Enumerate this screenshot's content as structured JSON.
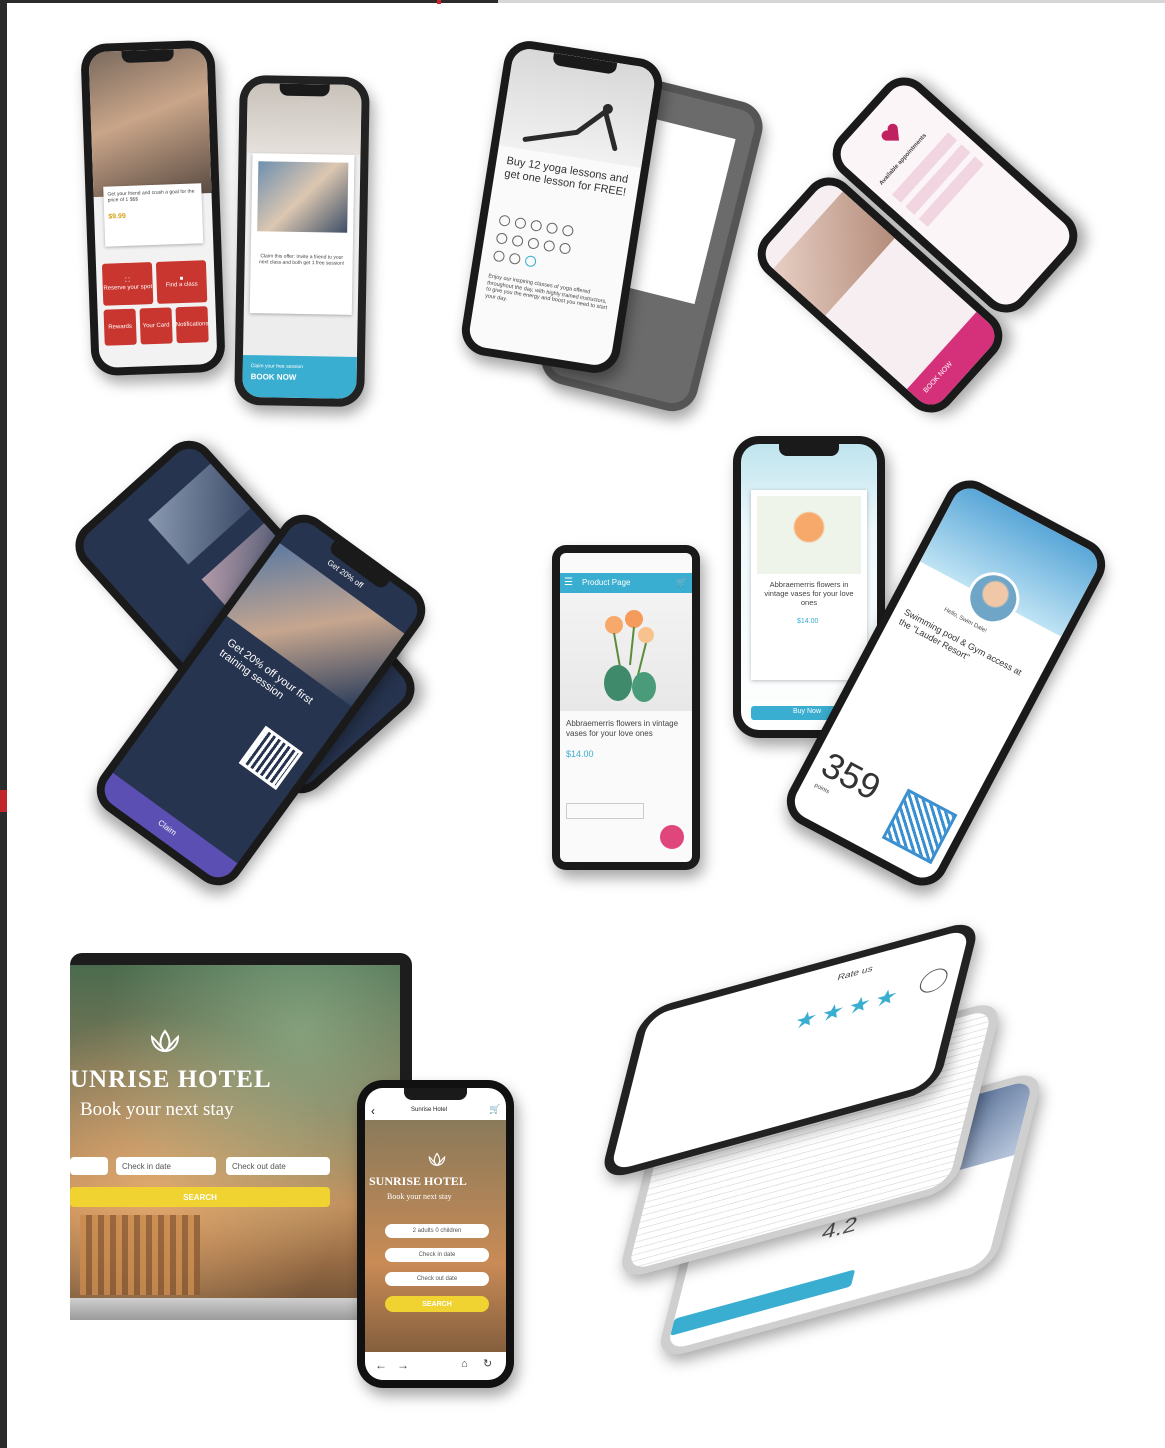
{
  "gym": {
    "promo_text": "Get your friend and crush a goal for the price of 1 $$$",
    "price": "$9.99",
    "tiles": [
      "Reserve your spot",
      "Find a class",
      "Rewards",
      "Your Card",
      "Notifications"
    ],
    "book_label": "BOOK NOW",
    "book_caption": "Claim your free session",
    "offer_text": "Claim this offer: Invite a friend to your next class and both get 1 free session!"
  },
  "yoga": {
    "headline": "Buy 12 yoga lessons and get one lesson for FREE!",
    "body": "Enjoy our inspiring classes of yoga offered throughout the day, with highly trained instructors, to give you the energy and boost you need to start your day."
  },
  "spa": {
    "appointments_label": "Available appointments",
    "book_label": "BOOK NOW"
  },
  "fitness_offer": {
    "headline": "Get 20% off your first training session",
    "title": "Get 20% off",
    "claim_label": "Claim"
  },
  "flowers": {
    "page_title": "Product Page",
    "product_name": "Abbraemerris flowers in vintage vases for your love ones",
    "price": "$14.00",
    "buy_label": "Buy Now"
  },
  "pool": {
    "greeting": "Hello, Swim Dale!",
    "headline": "Swimming pool & Gym access at the \"Lauder Resort\"",
    "points": "359",
    "points_label": "points"
  },
  "hotel": {
    "brand": "UNRISE HOTEL",
    "tagline": "Book your next stay",
    "check_in": "Check in date",
    "check_out": "Check out date",
    "search": "SEARCH",
    "mobile_title": "Sunrise Hotel",
    "mobile_brand": "SUNRISE HOTEL",
    "mobile_tagline": "Book your next stay",
    "mobile_guests": "2 adults 0 children",
    "mobile_check_in": "Check in date",
    "mobile_check_out": "Check out date",
    "mobile_search": "SEARCH"
  },
  "rating": {
    "title": "Rate us",
    "score": "4.2"
  },
  "colors": {
    "gym_red": "#c8362f",
    "teal": "#3aaed0",
    "pink": "#d4317a",
    "navy": "#27344f",
    "hotel_yellow": "#f0d230"
  }
}
